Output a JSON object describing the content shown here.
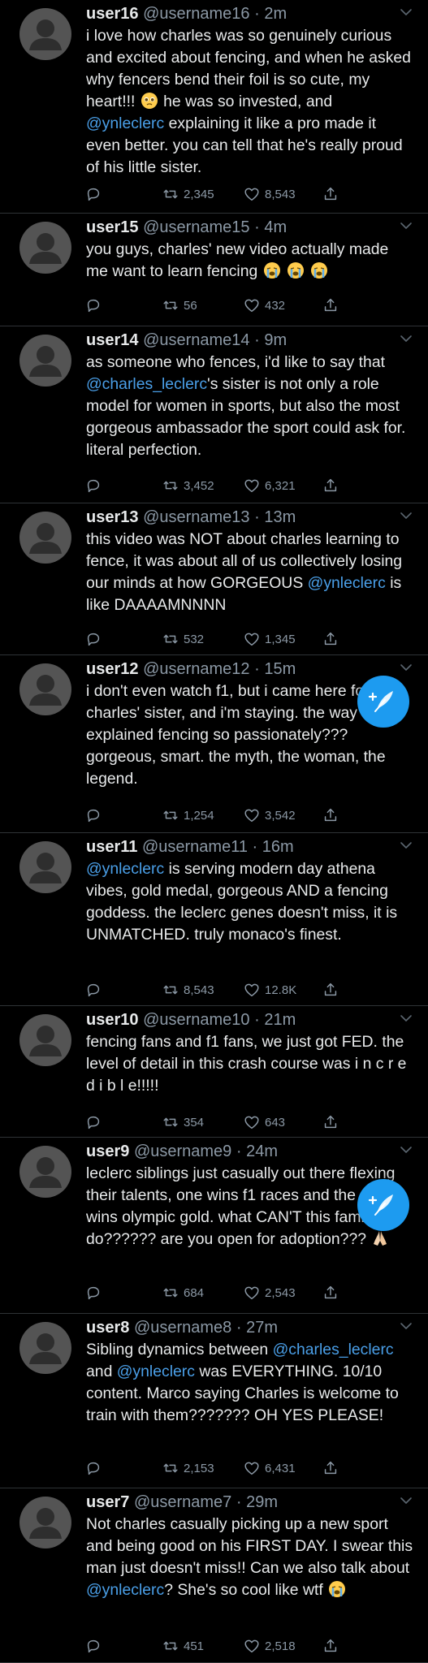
{
  "tweets": [
    {
      "name": "user16",
      "handle": "@username16",
      "time": "2m",
      "segments": [
        {
          "t": "text",
          "v": "i love how charles was so genuinely curious and excited about fencing, and when he asked why fencers bend their foil is so cute, my heart!!! "
        },
        {
          "t": "emoji",
          "v": "pleading-face"
        },
        {
          "t": "text",
          "v": " he was so invested, and "
        },
        {
          "t": "mention",
          "v": "@ynleclerc"
        },
        {
          "t": "text",
          "v": " explaining it like a pro made it even better. you can tell that he's really proud of his little sister."
        }
      ],
      "replies": "",
      "retweets": "2,345",
      "likes": "8,543"
    },
    {
      "name": "user15",
      "handle": "@username15",
      "time": "4m",
      "segments": [
        {
          "t": "text",
          "v": "you guys, charles' new video actually made me want to learn fencing "
        },
        {
          "t": "emoji",
          "v": "loudly-crying-face"
        },
        {
          "t": "text",
          "v": " "
        },
        {
          "t": "emoji",
          "v": "loudly-crying-face"
        },
        {
          "t": "text",
          "v": " "
        },
        {
          "t": "emoji",
          "v": "loudly-crying-face"
        }
      ],
      "replies": "",
      "retweets": "56",
      "likes": "432"
    },
    {
      "name": "user14",
      "handle": "@username14",
      "time": "9m",
      "segments": [
        {
          "t": "text",
          "v": "as someone who fences, i'd like to say that "
        },
        {
          "t": "mention",
          "v": "@charles_leclerc"
        },
        {
          "t": "text",
          "v": "'s sister is not only a role model for women in sports, but also the most gorgeous ambassador the sport could ask for. literal perfection."
        }
      ],
      "replies": "",
      "retweets": "3,452",
      "likes": "6,321"
    },
    {
      "name": "user13",
      "handle": "@username13",
      "time": "13m",
      "segments": [
        {
          "t": "text",
          "v": "this video was NOT about charles learning to fence, it was about all of us collectively losing our minds at how GORGEOUS "
        },
        {
          "t": "mention",
          "v": "@ynleclerc"
        },
        {
          "t": "text",
          "v": " is like DAAAAMNNNN"
        }
      ],
      "replies": "",
      "retweets": "532",
      "likes": "1,345"
    },
    {
      "name": "user12",
      "handle": "@username12",
      "time": "15m",
      "segments": [
        {
          "t": "text",
          "v": "i don't even watch f1, but i came here for charles' sister, and i'm staying. the way she explained fencing so passionately??? gorgeous, smart. the myth, the woman, the legend."
        }
      ],
      "replies": "",
      "retweets": "1,254",
      "likes": "3,542"
    },
    {
      "name": "user11",
      "handle": "@username11",
      "time": "16m",
      "segments": [
        {
          "t": "mention",
          "v": "@ynleclerc"
        },
        {
          "t": "text",
          "v": " is serving modern day athena vibes, gold medal, gorgeous AND a fencing goddess. the leclerc genes doesn't miss, it is UNMATCHED. truly monaco's finest."
        }
      ],
      "replies": "",
      "retweets": "8,543",
      "likes": "12.8K"
    },
    {
      "name": "user10",
      "handle": "@username10",
      "time": "21m",
      "segments": [
        {
          "t": "text",
          "v": "fencing fans and f1 fans, we just got FED. the level of detail in this crash course was i n c r e d i b l e!!!!!"
        }
      ],
      "replies": "",
      "retweets": "354",
      "likes": "643"
    },
    {
      "name": "user9",
      "handle": "@username9",
      "time": "24m",
      "segments": [
        {
          "t": "text",
          "v": "leclerc siblings just casually out there flexing their talents, one wins f1 races and the other wins olympic gold. what CAN'T this family do?????? are you open for adoption??? "
        },
        {
          "t": "emoji",
          "v": "folded-hands"
        }
      ],
      "replies": "",
      "retweets": "684",
      "likes": "2,543"
    },
    {
      "name": "user8",
      "handle": "@username8",
      "time": "27m",
      "segments": [
        {
          "t": "text",
          "v": "Sibling dynamics between "
        },
        {
          "t": "mention",
          "v": "@charles_leclerc"
        },
        {
          "t": "text",
          "v": " and "
        },
        {
          "t": "mention",
          "v": "@ynleclerc"
        },
        {
          "t": "text",
          "v": " was EVERYTHING. 10/10 content. Marco saying Charles is welcome to train with them??????? OH YES PLEASE!"
        }
      ],
      "replies": "",
      "retweets": "2,153",
      "likes": "6,431"
    },
    {
      "name": "user7",
      "handle": "@username7",
      "time": "29m",
      "segments": [
        {
          "t": "text",
          "v": "Not charles casually picking up a new sport and being good on his FIRST DAY. I swear this man just doesn't miss!! Can we also talk about "
        },
        {
          "t": "mention",
          "v": "@ynleclerc"
        },
        {
          "t": "text",
          "v": "? She's so cool like wtf "
        },
        {
          "t": "emoji",
          "v": "loudly-crying-face"
        }
      ],
      "replies": "",
      "retweets": "451",
      "likes": "2,518"
    }
  ],
  "compose_button": {
    "icon": "feather-plus-icon"
  },
  "colors": {
    "background": "#000000",
    "text": "#e7e9ea",
    "muted": "#8b98a5",
    "mention": "#4a9fe8",
    "accent": "#1d9bf0",
    "divider": "#2f3336"
  }
}
